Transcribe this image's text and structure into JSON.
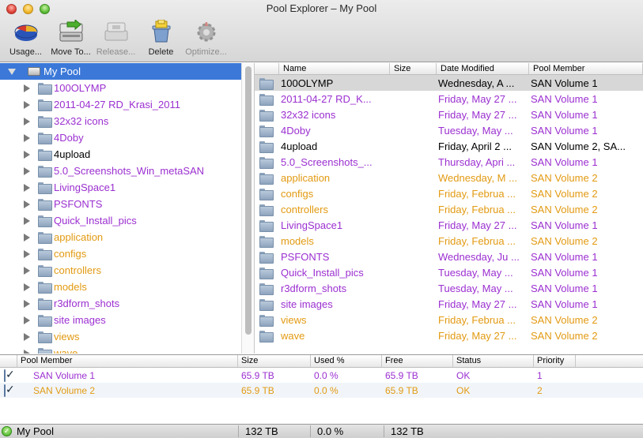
{
  "window": {
    "title": "Pool Explorer – My Pool"
  },
  "colors": {
    "san1": "#9b2fd0",
    "san2": "#e29a12",
    "default": "#000000",
    "selection": "#3b78d8"
  },
  "toolbar": [
    {
      "label": "Usage...",
      "icon": "pie-chart-icon",
      "enabled": true
    },
    {
      "label": "Move To...",
      "icon": "move-to-icon",
      "enabled": true
    },
    {
      "label": "Release...",
      "icon": "release-icon",
      "enabled": false
    },
    {
      "label": "Delete",
      "icon": "trash-icon",
      "enabled": true
    },
    {
      "label": "Optimize...",
      "icon": "gear-icon",
      "enabled": false
    }
  ],
  "tree": {
    "root": "My Pool",
    "items": [
      {
        "label": "100OLYMP",
        "color": "#9b2fd0"
      },
      {
        "label": "2011-04-27 RD_Krasi_2011",
        "color": "#9b2fd0"
      },
      {
        "label": "32x32 icons",
        "color": "#9b2fd0"
      },
      {
        "label": "4Doby",
        "color": "#9b2fd0"
      },
      {
        "label": "4upload",
        "color": "#000000"
      },
      {
        "label": "5.0_Screenshots_Win_metaSAN",
        "color": "#9b2fd0"
      },
      {
        "label": "LivingSpace1",
        "color": "#9b2fd0"
      },
      {
        "label": "PSFONTS",
        "color": "#9b2fd0"
      },
      {
        "label": "Quick_Install_pics",
        "color": "#9b2fd0"
      },
      {
        "label": "application",
        "color": "#e29a12"
      },
      {
        "label": "configs",
        "color": "#e29a12"
      },
      {
        "label": "controllers",
        "color": "#e29a12"
      },
      {
        "label": "models",
        "color": "#e29a12"
      },
      {
        "label": "r3dform_shots",
        "color": "#9b2fd0"
      },
      {
        "label": "site images",
        "color": "#9b2fd0"
      },
      {
        "label": "views",
        "color": "#e29a12"
      },
      {
        "label": "wave",
        "color": "#e29a12"
      }
    ]
  },
  "filelist": {
    "columns": [
      "Name",
      "Size",
      "Date Modified",
      "Pool Member"
    ],
    "rows": [
      {
        "name": "100OLYMP",
        "size": "",
        "date": "Wednesday, A ...",
        "member": "SAN Volume 1",
        "color": "#000000",
        "selected": true
      },
      {
        "name": "2011-04-27 RD_K...",
        "size": "",
        "date": "Friday, May 27 ...",
        "member": "SAN Volume 1",
        "color": "#9b2fd0"
      },
      {
        "name": "32x32 icons",
        "size": "",
        "date": "Friday, May 27 ...",
        "member": "SAN Volume 1",
        "color": "#9b2fd0"
      },
      {
        "name": "4Doby",
        "size": "",
        "date": "Tuesday, May  ...",
        "member": "SAN Volume 1",
        "color": "#9b2fd0"
      },
      {
        "name": "4upload",
        "size": "",
        "date": "Friday, April 2 ...",
        "member": "SAN Volume 2, SA...",
        "color": "#000000"
      },
      {
        "name": "5.0_Screenshots_...",
        "size": "",
        "date": "Thursday, Apri ...",
        "member": "SAN Volume 1",
        "color": "#9b2fd0"
      },
      {
        "name": "application",
        "size": "",
        "date": "Wednesday, M ...",
        "member": "SAN Volume 2",
        "color": "#e29a12"
      },
      {
        "name": "configs",
        "size": "",
        "date": "Friday, Februa ...",
        "member": "SAN Volume 2",
        "color": "#e29a12"
      },
      {
        "name": "controllers",
        "size": "",
        "date": "Friday, Februa ...",
        "member": "SAN Volume 2",
        "color": "#e29a12"
      },
      {
        "name": "LivingSpace1",
        "size": "",
        "date": "Friday, May 27 ...",
        "member": "SAN Volume 1",
        "color": "#9b2fd0"
      },
      {
        "name": "models",
        "size": "",
        "date": "Friday, Februa ...",
        "member": "SAN Volume 2",
        "color": "#e29a12"
      },
      {
        "name": "PSFONTS",
        "size": "",
        "date": "Wednesday, Ju ...",
        "member": "SAN Volume 1",
        "color": "#9b2fd0"
      },
      {
        "name": "Quick_Install_pics",
        "size": "",
        "date": "Tuesday, May  ...",
        "member": "SAN Volume 1",
        "color": "#9b2fd0"
      },
      {
        "name": "r3dform_shots",
        "size": "",
        "date": "Tuesday, May  ...",
        "member": "SAN Volume 1",
        "color": "#9b2fd0"
      },
      {
        "name": "site images",
        "size": "",
        "date": "Friday, May 27 ...",
        "member": "SAN Volume 1",
        "color": "#9b2fd0"
      },
      {
        "name": "views",
        "size": "",
        "date": "Friday, Februa ...",
        "member": "SAN Volume 2",
        "color": "#e29a12"
      },
      {
        "name": "wave",
        "size": "",
        "date": "Friday, May 27 ...",
        "member": "SAN Volume 2",
        "color": "#e29a12"
      }
    ]
  },
  "pool_members": {
    "columns": [
      "Pool Member",
      "Size",
      "Used %",
      "Free",
      "Status",
      "Priority"
    ],
    "rows": [
      {
        "checked": true,
        "name": "SAN Volume 1",
        "size": "65.9 TB",
        "used": "0.0 %",
        "free": "65.9 TB",
        "status": "OK",
        "priority": "1",
        "color": "#9b2fd0"
      },
      {
        "checked": true,
        "name": "SAN Volume 2",
        "size": "65.9 TB",
        "used": "0.0 %",
        "free": "65.9 TB",
        "status": "OK",
        "priority": "2",
        "color": "#e29a12"
      }
    ]
  },
  "status": {
    "pool": "My Pool",
    "size": "132 TB",
    "used": "0.0 %",
    "free": "132 TB"
  }
}
